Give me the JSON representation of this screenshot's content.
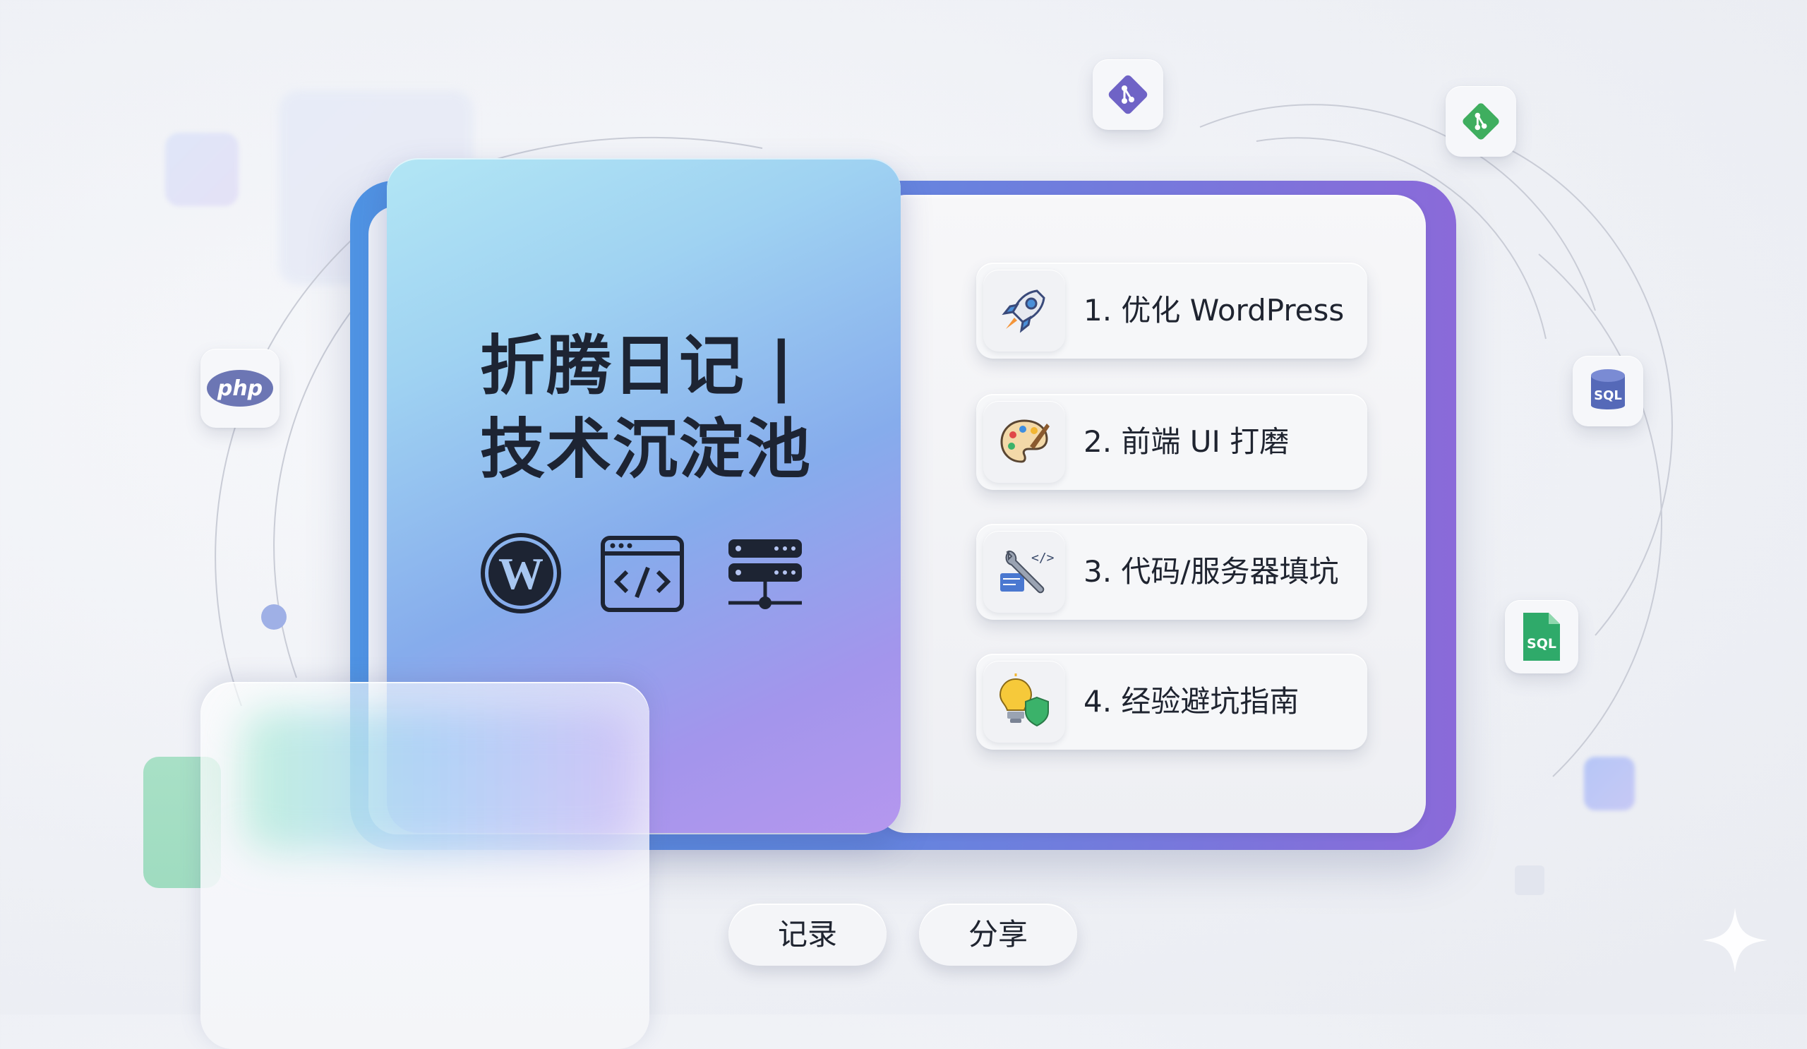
{
  "cover": {
    "title_line1": "折腾日记 |",
    "title_line2": "技术沉淀池",
    "icons": [
      "wordpress-icon",
      "code-window-icon",
      "server-icon"
    ]
  },
  "menu": [
    {
      "label": "1. 优化 WordPress",
      "icon": "rocket-icon"
    },
    {
      "label": "2. 前端 UI 打磨",
      "icon": "palette-icon"
    },
    {
      "label": "3. 代码/服务器填坑",
      "icon": "wrench-code-icon"
    },
    {
      "label": "4. 经验避坑指南",
      "icon": "lightbulb-shield-icon"
    }
  ],
  "buttons": {
    "record": "记录",
    "share": "分享"
  },
  "floating_badges": {
    "php": "php",
    "sql_db": "SQL",
    "sql_file": "SQL"
  },
  "colors": {
    "frame_start": "#4f93e3",
    "frame_end": "#8a6ad9",
    "git_purple": "#6f63c6",
    "git_green": "#3fae5f",
    "php": "#6c76b4",
    "sql_db": "#5569b8",
    "sql_file": "#2faa6a",
    "text": "#1f2430"
  }
}
